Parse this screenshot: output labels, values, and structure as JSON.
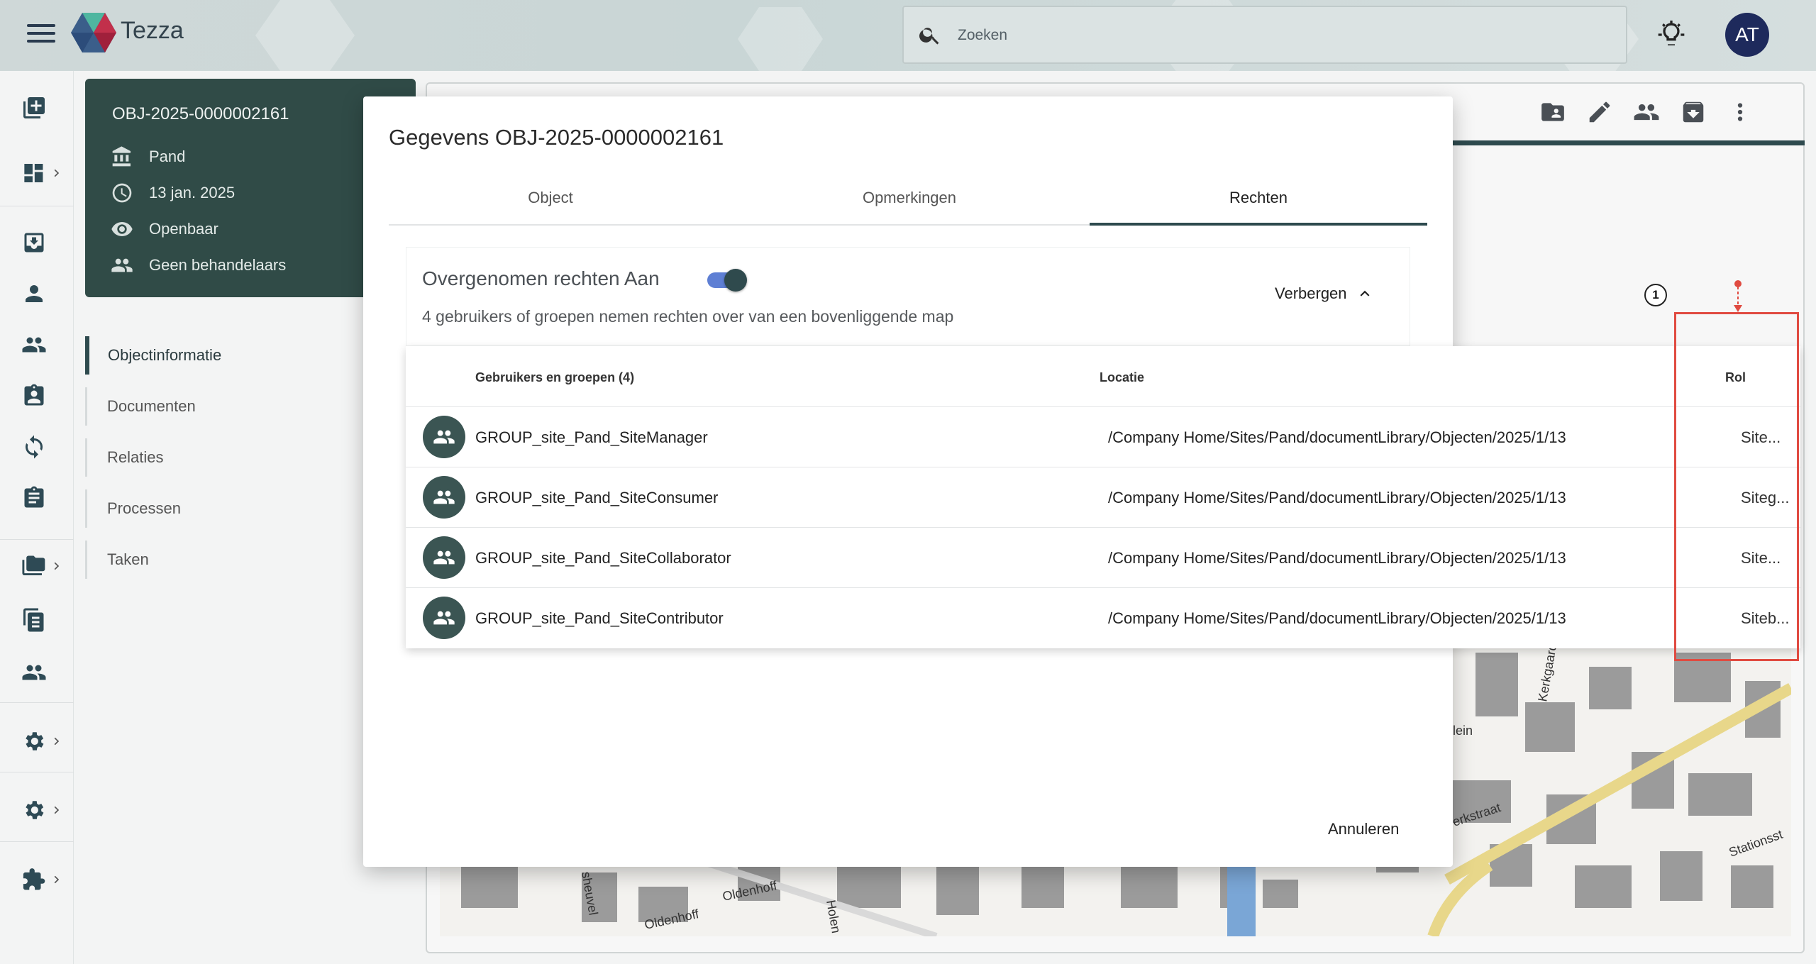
{
  "app": {
    "name": "Tezza"
  },
  "search": {
    "placeholder": "Zoeken"
  },
  "user": {
    "initials": "AT"
  },
  "object_card": {
    "title": "OBJ-2025-0000002161",
    "type": "Pand",
    "date": "13 jan. 2025",
    "visibility": "Openbaar",
    "handlers": "Geen behandelaars"
  },
  "left_nav": {
    "items": [
      {
        "label": "Objectinformatie"
      },
      {
        "label": "Documenten"
      },
      {
        "label": "Relaties"
      },
      {
        "label": "Processen"
      },
      {
        "label": "Taken"
      }
    ]
  },
  "map_labels": {
    "street_1": "Kerkgaarde",
    "street_2": "lein",
    "street_3": "erkstraat",
    "street_4": "Stationsst",
    "street_5": "Oldenhoff",
    "street_6": "Oldenhoff",
    "street_7": "Holen",
    "street_8": "sheuvel"
  },
  "modal": {
    "title": "Gegevens OBJ-2025-0000002161",
    "tabs": [
      {
        "label": "Object"
      },
      {
        "label": "Opmerkingen"
      },
      {
        "label": "Rechten"
      }
    ],
    "inherited": {
      "title": "Overgenomen rechten Aan",
      "subtitle": "4 gebruikers of groepen nemen rechten over van een bovenliggende map",
      "hide_label": "Verbergen"
    },
    "table": {
      "headers": {
        "users": "Gebruikers en groepen (4)",
        "location": "Locatie",
        "role": "Rol"
      },
      "rows": [
        {
          "name": "GROUP_site_Pand_SiteManager",
          "location": "/Company Home/Sites/Pand/documentLibrary/Objecten/2025/1/13",
          "role": "Site..."
        },
        {
          "name": "GROUP_site_Pand_SiteConsumer",
          "location": "/Company Home/Sites/Pand/documentLibrary/Objecten/2025/1/13",
          "role": "Siteg..."
        },
        {
          "name": "GROUP_site_Pand_SiteCollaborator",
          "location": "/Company Home/Sites/Pand/documentLibrary/Objecten/2025/1/13",
          "role": "Site..."
        },
        {
          "name": "GROUP_site_Pand_SiteContributor",
          "location": "/Company Home/Sites/Pand/documentLibrary/Objecten/2025/1/13",
          "role": "Siteb..."
        }
      ]
    },
    "cancel_label": "Annuleren"
  },
  "annotation": {
    "badge": "1"
  },
  "colors": {
    "accent": "#2e4a4e",
    "toggle_track": "#5e7fd4",
    "avatar": "#1e2a5c",
    "annotation": "#e04b41"
  }
}
